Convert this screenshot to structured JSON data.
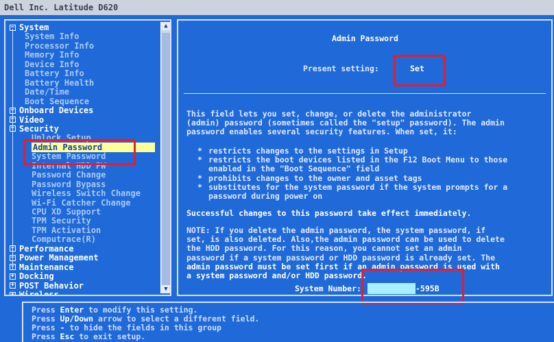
{
  "window": {
    "title": "Dell Inc. Latitude D620"
  },
  "tree": [
    {
      "label": "System",
      "kind": "cat"
    },
    {
      "label": "System Info",
      "kind": "sub"
    },
    {
      "label": "Processor Info",
      "kind": "sub"
    },
    {
      "label": "Memory Info",
      "kind": "sub"
    },
    {
      "label": "Device Info",
      "kind": "sub"
    },
    {
      "label": "Battery Info",
      "kind": "sub"
    },
    {
      "label": "Battery Health",
      "kind": "sub"
    },
    {
      "label": "Date/Time",
      "kind": "sub"
    },
    {
      "label": "Boot Sequence",
      "kind": "sub"
    },
    {
      "label": "Onboard Devices",
      "kind": "cat"
    },
    {
      "label": "Video",
      "kind": "cat"
    },
    {
      "label": "Security",
      "kind": "cat"
    },
    {
      "label": "Unlock Setup",
      "kind": "sub"
    },
    {
      "label": "Admin Password",
      "kind": "sel"
    },
    {
      "label": "System Password",
      "kind": "sub"
    },
    {
      "label": "Internal HDD PW",
      "kind": "sub"
    },
    {
      "label": "Password Change",
      "kind": "sub"
    },
    {
      "label": "Password Bypass",
      "kind": "sub"
    },
    {
      "label": "Wireless Switch Change",
      "kind": "sub"
    },
    {
      "label": "Wi-Fi Catcher Change",
      "kind": "sub"
    },
    {
      "label": "CPU XD Support",
      "kind": "sub"
    },
    {
      "label": "TPM Security",
      "kind": "sub"
    },
    {
      "label": "TPM Activation",
      "kind": "sub"
    },
    {
      "label": "Computrace(R)",
      "kind": "sub"
    },
    {
      "label": "Performance",
      "kind": "cat"
    },
    {
      "label": "Power Management",
      "kind": "cat"
    },
    {
      "label": "Maintenance",
      "kind": "cat"
    },
    {
      "label": "Docking",
      "kind": "cat"
    },
    {
      "label": "POST Behavior",
      "kind": "cat"
    },
    {
      "label": "Wireless",
      "kind": "cat"
    }
  ],
  "detail": {
    "title": "Admin Password",
    "present_label": "Present setting:",
    "present_value": "Set",
    "desc": [
      "This field lets you set, change, or delete the administrator",
      "(admin) password (sometimes called the \"setup\" password). The admin",
      "password enables several security features. When set, it:"
    ],
    "bullets": [
      [
        "restricts changes to the settings in Setup"
      ],
      [
        "restricts the boot devices listed in the F12 Boot Menu to those",
        "enabled in the \"Boot Sequence\" field"
      ],
      [
        "prohibits changes to the owner and asset tags"
      ],
      [
        "substitutes for the system password if the system prompts for a",
        "password during power on"
      ]
    ],
    "success": "Successful changes to this password take effect immediately.",
    "note": [
      "NOTE: If you delete the admin password, the system password, if",
      "set, is also deleted. Also,the admin password can be used to delete",
      "the HDD password.  For this reason, you cannot set an admin",
      "password if a system password or HDD password is already set. The",
      "admin password must be set first if an admin password is used with",
      "a system password and/or HDD password."
    ],
    "system_number_label": "System Number:",
    "system_number_suffix": "-595B"
  },
  "help": {
    "line1": {
      "pre": "Press ",
      "key": "Enter",
      "post": " to modify this setting."
    },
    "line2": {
      "pre": "Press ",
      "key": "Up/Down",
      "post": " arrow to select a different field."
    },
    "line3": {
      "pre": "Press ",
      "key": "-",
      "post": " to hide the fields in this group"
    },
    "line4": {
      "pre": "Press ",
      "key": "Esc",
      "post": " to exit setup."
    }
  },
  "colors": {
    "bios_blue": "#1f6ad8",
    "highlight": "#ffff99",
    "annotation_red": "#ea1c2c",
    "mask": "#a8f0ff"
  }
}
